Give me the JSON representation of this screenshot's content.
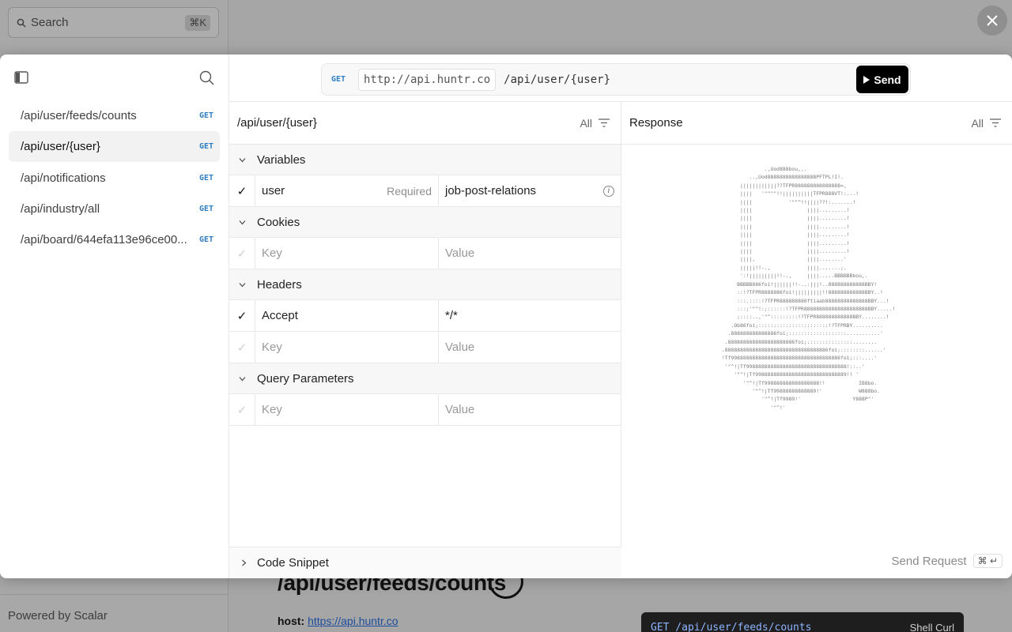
{
  "background": {
    "search_placeholder": "Search",
    "search_shortcut": "⌘K",
    "powered_by": "Powered by Scalar",
    "endpoint_title": "/api/user/feeds/counts",
    "host_label": "host:",
    "host_link": "https://api.huntr.co",
    "code_example": "GET /api/user/feeds/counts",
    "code_language": "Shell Curl"
  },
  "sidebar": {
    "items": [
      {
        "path": "/api/user/feeds/counts",
        "method": "GET"
      },
      {
        "path": "/api/user/{user}",
        "method": "GET",
        "active": true
      },
      {
        "path": "/api/notifications",
        "method": "GET"
      },
      {
        "path": "/api/industry/all",
        "method": "GET"
      },
      {
        "path": "/api/board/644efa113e96ce00...",
        "method": "GET"
      }
    ]
  },
  "request_bar": {
    "method": "GET",
    "server": "http://api.huntr.co",
    "path": "/api/user/{user}",
    "send_label": "Send"
  },
  "request": {
    "title": "/api/user/{user}",
    "filter_label": "All",
    "sections": {
      "variables": "Variables",
      "cookies": "Cookies",
      "headers": "Headers",
      "query": "Query Parameters",
      "code_snippet": "Code Snippet"
    },
    "variable_row": {
      "key": "user",
      "required": "Required",
      "value": "job-post-relations"
    },
    "header_row": {
      "key": "Accept",
      "value": "*/*"
    },
    "key_placeholder": "Key",
    "value_placeholder": "Value"
  },
  "response": {
    "title": "Response",
    "filter_label": "All",
    "send_request_label": "Send Request",
    "shortcut": "⌘ ↵"
  }
}
